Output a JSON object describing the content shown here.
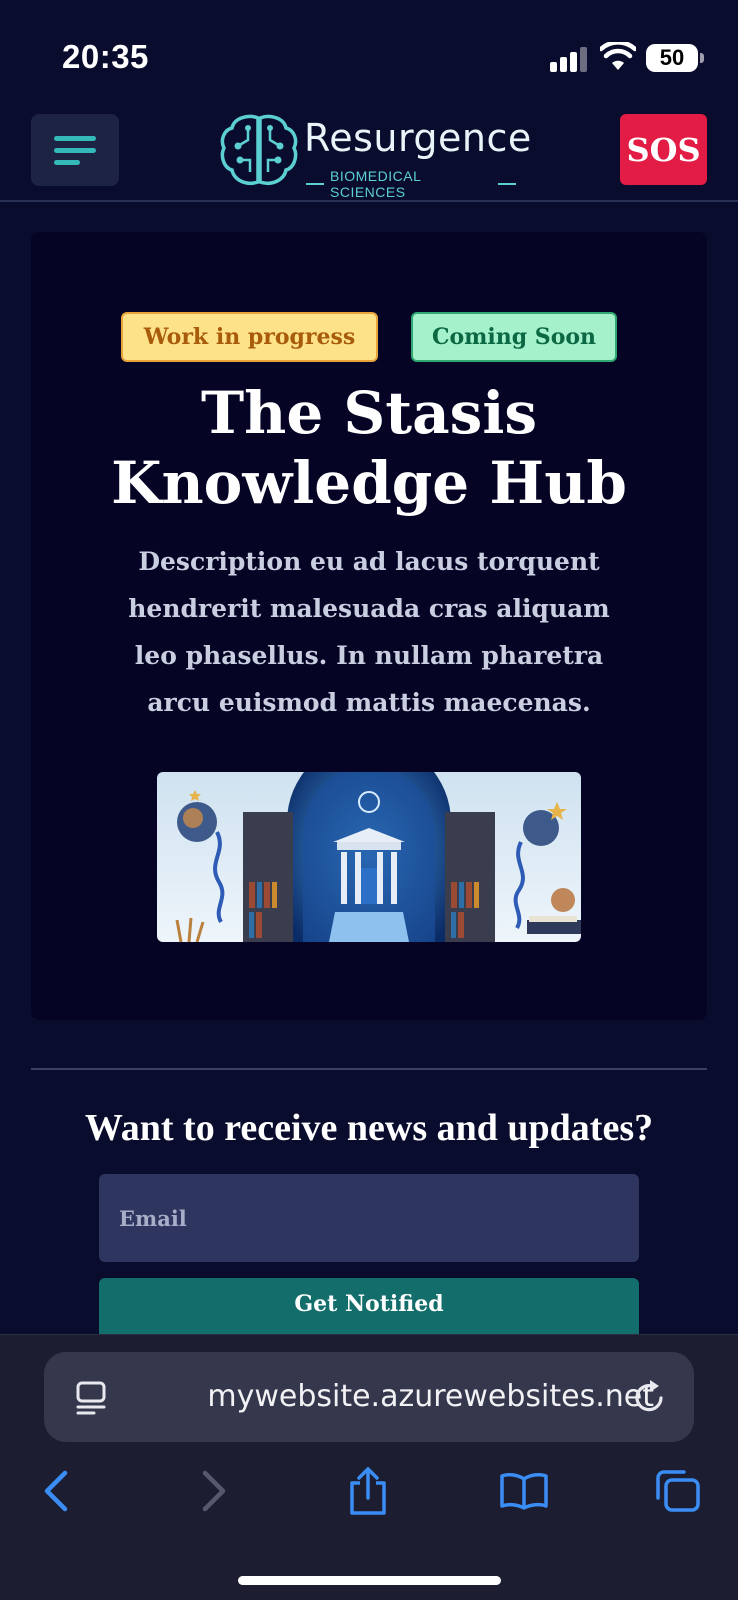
{
  "status_bar": {
    "time": "20:35",
    "battery": "50"
  },
  "header": {
    "menu_icon": "hamburger-icon",
    "logo": {
      "name": "Resurgence",
      "tagline": "BIOMEDICAL SCIENCES",
      "icon": "brain-circuit-icon"
    },
    "sos_label": "SOS",
    "colors": {
      "accent": "#35b8b8",
      "sos": "#e31c45"
    }
  },
  "hero": {
    "badges": [
      {
        "label": "Work in progress",
        "color": "#fde28a"
      },
      {
        "label": "Coming Soon",
        "color": "#a4f1cb"
      }
    ],
    "title": "The Stasis Knowledge Hub",
    "description": "Description eu ad lacus torquent hendrerit malesuada cras aliquam leo phasellus. In nullam pharetra arcu euismod mattis maecenas.",
    "image_alt": "library-temple-illustration"
  },
  "newsletter": {
    "title": "Want to receive news and updates?",
    "email_placeholder": "Email",
    "button_label": "Get Notified"
  },
  "browser": {
    "url": "mywebsite.azurewebsites.net",
    "icons": [
      "reader-icon",
      "reload-icon",
      "back-icon",
      "forward-icon",
      "share-icon",
      "bookmarks-icon",
      "tabs-icon"
    ]
  }
}
